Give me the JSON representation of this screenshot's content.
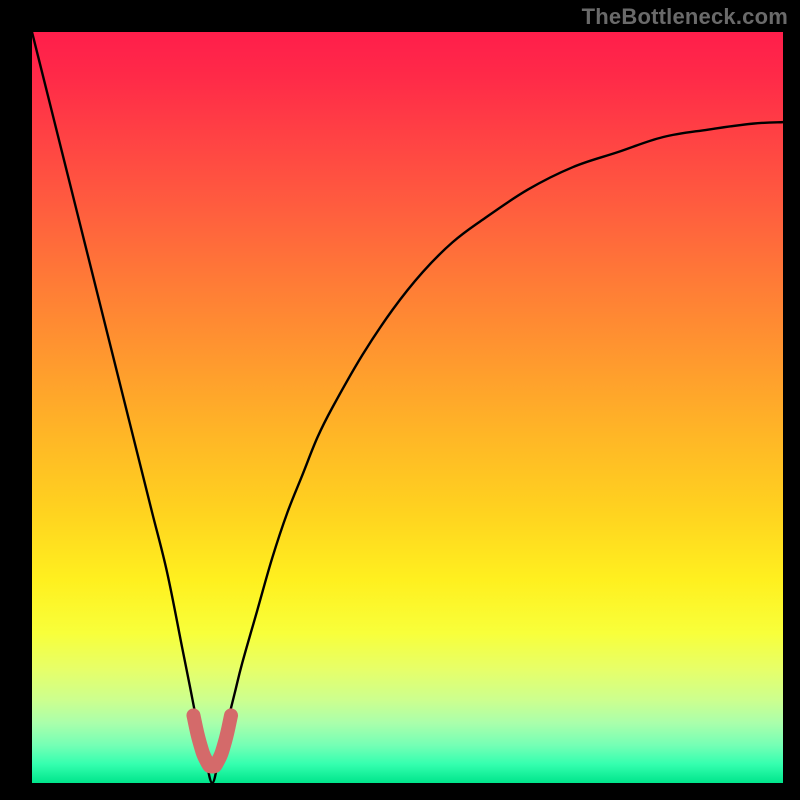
{
  "watermark": "TheBottleneck.com",
  "colors": {
    "frame": "#000000",
    "curve": "#000000",
    "marker": "#d46a6a",
    "gradient_stops": [
      {
        "offset": 0.0,
        "color": "#ff1e4b"
      },
      {
        "offset": 0.06,
        "color": "#ff2a48"
      },
      {
        "offset": 0.14,
        "color": "#ff4244"
      },
      {
        "offset": 0.24,
        "color": "#ff5f3e"
      },
      {
        "offset": 0.34,
        "color": "#ff7d36"
      },
      {
        "offset": 0.44,
        "color": "#ff9a2e"
      },
      {
        "offset": 0.54,
        "color": "#ffb726"
      },
      {
        "offset": 0.64,
        "color": "#ffd31f"
      },
      {
        "offset": 0.73,
        "color": "#fff01f"
      },
      {
        "offset": 0.8,
        "color": "#f8ff3a"
      },
      {
        "offset": 0.85,
        "color": "#e6ff6a"
      },
      {
        "offset": 0.89,
        "color": "#ccff8f"
      },
      {
        "offset": 0.92,
        "color": "#aaffab"
      },
      {
        "offset": 0.95,
        "color": "#74ffb5"
      },
      {
        "offset": 0.975,
        "color": "#34ffaf"
      },
      {
        "offset": 1.0,
        "color": "#00e58b"
      }
    ]
  },
  "chart_data": {
    "type": "line",
    "title": "",
    "xlabel": "",
    "ylabel": "",
    "xlim": [
      0,
      100
    ],
    "ylim": [
      0,
      100
    ],
    "grid": false,
    "legend": false,
    "x_star": 24,
    "series": [
      {
        "name": "bottleneck-curve",
        "x": [
          0,
          2,
          4,
          6,
          8,
          10,
          12,
          14,
          16,
          18,
          20,
          21,
          22,
          23,
          24,
          25,
          26,
          27,
          28,
          30,
          32,
          34,
          36,
          38,
          40,
          44,
          48,
          52,
          56,
          60,
          66,
          72,
          78,
          84,
          90,
          96,
          100
        ],
        "y": [
          100,
          92,
          84,
          76,
          68,
          60,
          52,
          44,
          36,
          28,
          18,
          13,
          8,
          4,
          0,
          4,
          8,
          12,
          16,
          23,
          30,
          36,
          41,
          46,
          50,
          57,
          63,
          68,
          72,
          75,
          79,
          82,
          84,
          86,
          87,
          87.8,
          88
        ]
      }
    ],
    "marker": {
      "name": "optimal-range",
      "shape": "u",
      "points": [
        {
          "x": 21.5,
          "y": 9.0
        },
        {
          "x": 22.3,
          "y": 5.5
        },
        {
          "x": 23.2,
          "y": 3.0
        },
        {
          "x": 24.0,
          "y": 2.2
        },
        {
          "x": 24.8,
          "y": 3.0
        },
        {
          "x": 25.7,
          "y": 5.5
        },
        {
          "x": 26.5,
          "y": 9.0
        }
      ]
    }
  }
}
